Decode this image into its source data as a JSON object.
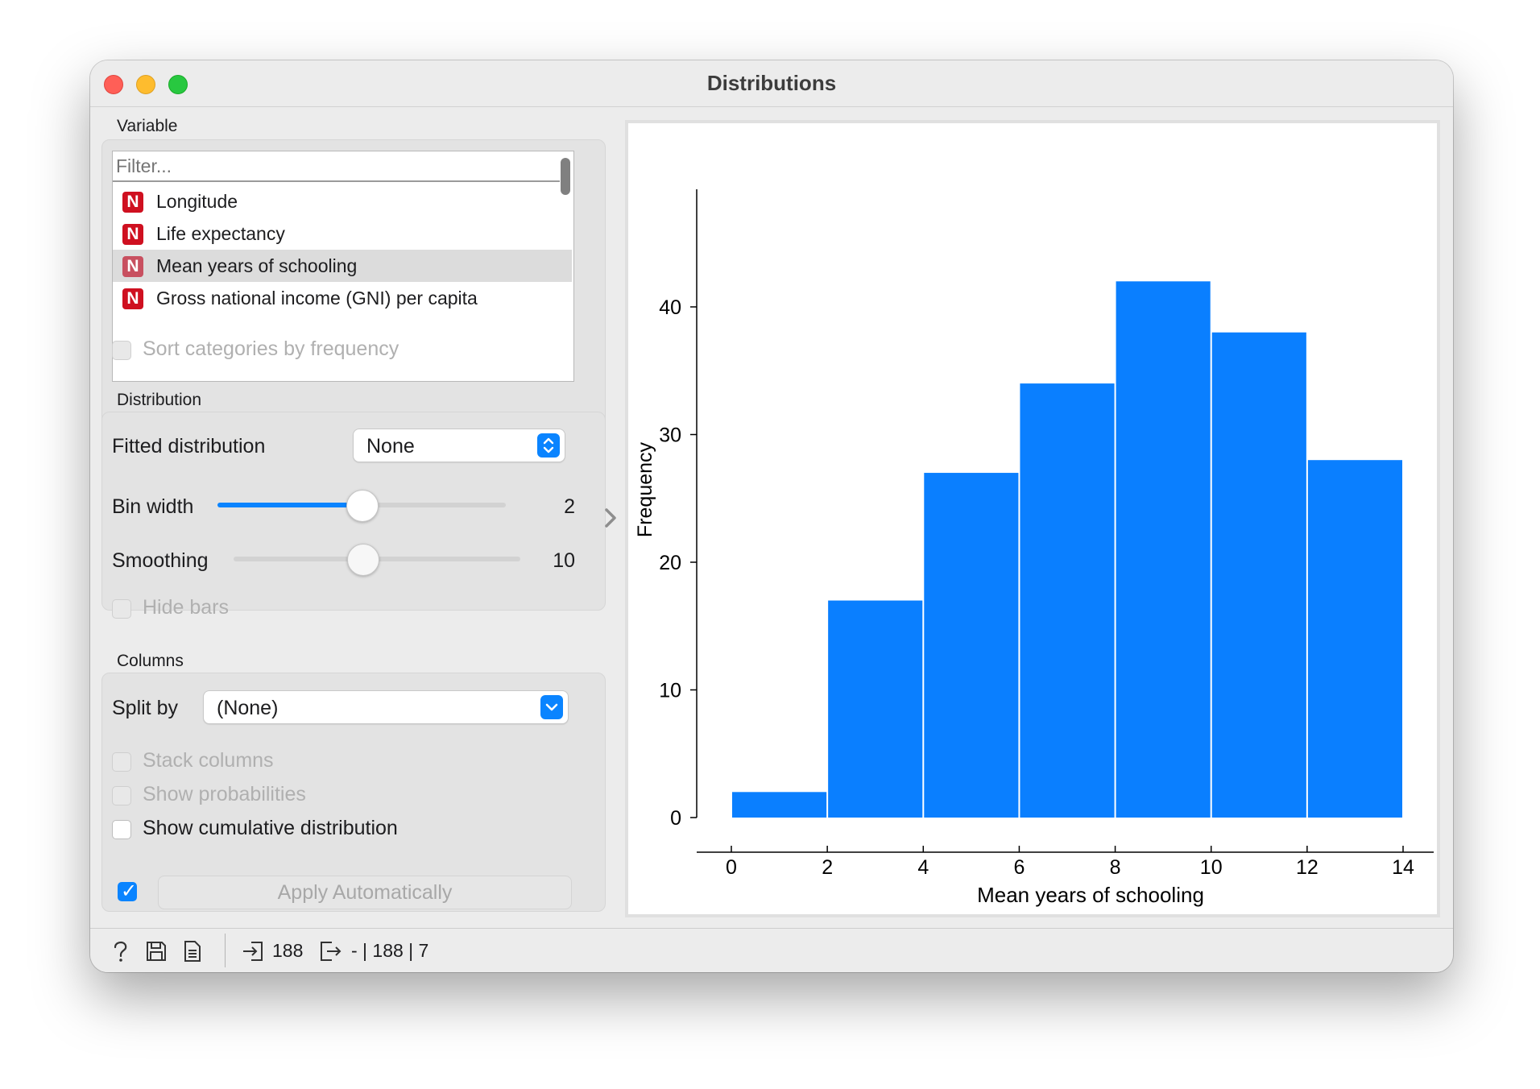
{
  "window": {
    "title": "Distributions"
  },
  "variable": {
    "group_label": "Variable",
    "filter_placeholder": "Filter...",
    "items": [
      {
        "badge": "N",
        "label": "Longitude"
      },
      {
        "badge": "N",
        "label": "Life expectancy"
      },
      {
        "badge": "N",
        "label": "Mean years of schooling",
        "selected": true
      },
      {
        "badge": "N",
        "label": "Gross national income (GNI) per capita"
      }
    ],
    "sort_label": "Sort categories by frequency"
  },
  "distribution": {
    "group_label": "Distribution",
    "fitted_label": "Fitted distribution",
    "fitted_value": "None",
    "bin_width_label": "Bin width",
    "bin_width_value": "2",
    "bin_width_level": 0.5,
    "smoothing_label": "Smoothing",
    "smoothing_value": "10",
    "smoothing_level": 0.45,
    "hide_bars_label": "Hide bars"
  },
  "columns": {
    "group_label": "Columns",
    "split_by_label": "Split by",
    "split_by_value": "(None)",
    "stack_label": "Stack columns",
    "probabilities_label": "Show probabilities",
    "cumulative_label": "Show cumulative distribution"
  },
  "apply": {
    "checked": true,
    "label": "Apply Automatically"
  },
  "status": {
    "input_count": "188",
    "output_text": "- | 188 | 7"
  },
  "colors": {
    "bar": "#0a7fff",
    "accent": "#0a84ff",
    "badge": "#cf1020"
  },
  "icons": [
    "help-icon",
    "save-icon",
    "report-icon",
    "input-icon",
    "output-icon",
    "chevron-right-icon",
    "updown-arrows-icon",
    "chevron-down-icon"
  ],
  "chart_data": {
    "type": "bar",
    "bins": [
      [
        0,
        2
      ],
      [
        2,
        4
      ],
      [
        4,
        6
      ],
      [
        6,
        8
      ],
      [
        8,
        10
      ],
      [
        10,
        12
      ],
      [
        12,
        14
      ]
    ],
    "values": [
      2,
      17,
      27,
      34,
      42,
      38,
      28
    ],
    "xlabel": "Mean years of schooling",
    "ylabel": "Frequency",
    "xlim": [
      0,
      14
    ],
    "ylim": [
      0,
      42
    ],
    "xticks": [
      0,
      2,
      4,
      6,
      8,
      10,
      12,
      14
    ],
    "yticks": [
      0,
      10,
      20,
      30,
      40
    ],
    "grid": false
  }
}
